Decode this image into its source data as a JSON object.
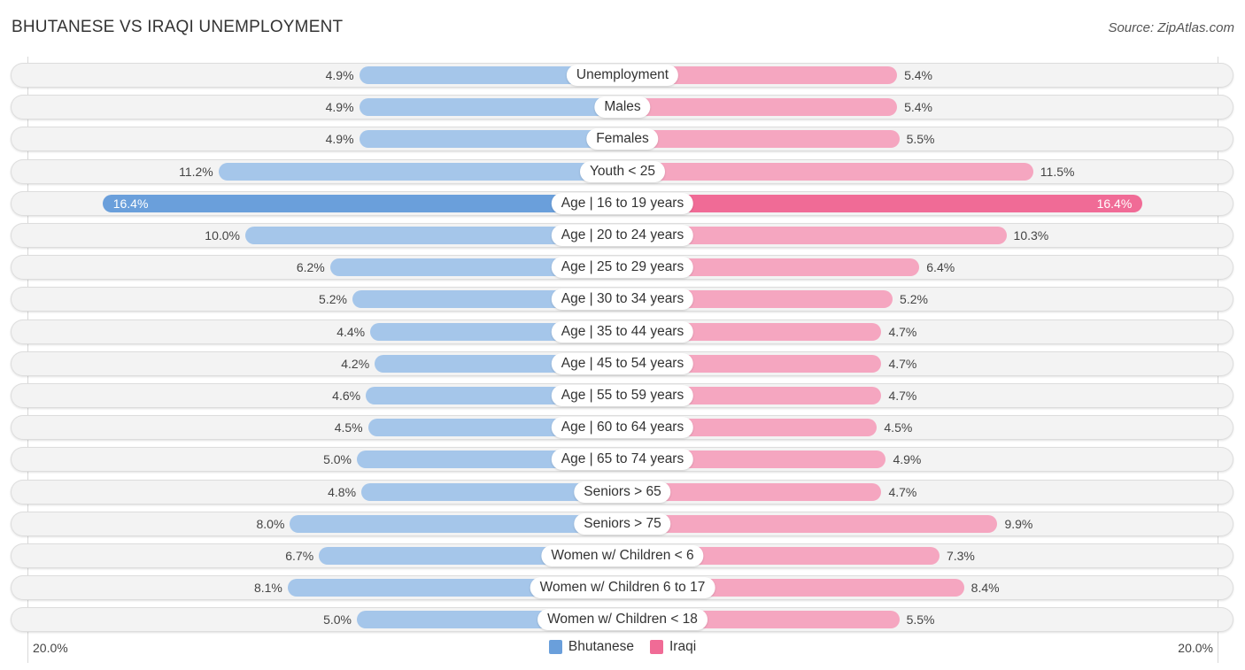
{
  "header": {
    "title": "BHUTANESE VS IRAQI UNEMPLOYMENT",
    "source": "Source: ZipAtlas.com"
  },
  "colors": {
    "bhutanese": "#a5c6ea",
    "bhutanese_strong": "#6a9fdb",
    "iraqi": "#f5a6c0",
    "iraqi_strong": "#f06b96"
  },
  "chart_data": {
    "type": "bar",
    "orientation": "horizontal-diverging",
    "title": "BHUTANESE VS IRAQI UNEMPLOYMENT",
    "categories": [
      "Unemployment",
      "Males",
      "Females",
      "Youth < 25",
      "Age | 16 to 19 years",
      "Age | 20 to 24 years",
      "Age | 25 to 29 years",
      "Age | 30 to 34 years",
      "Age | 35 to 44 years",
      "Age | 45 to 54 years",
      "Age | 55 to 59 years",
      "Age | 60 to 64 years",
      "Age | 65 to 74 years",
      "Seniors > 65",
      "Seniors > 75",
      "Women w/ Children < 6",
      "Women w/ Children 6 to 17",
      "Women w/ Children < 18"
    ],
    "series": [
      {
        "name": "Bhutanese",
        "side": "left",
        "values": [
          4.9,
          4.9,
          4.9,
          11.2,
          16.4,
          10.0,
          6.2,
          5.2,
          4.4,
          4.2,
          4.6,
          4.5,
          5.0,
          4.8,
          8.0,
          6.7,
          8.1,
          5.0
        ],
        "labels": [
          "4.9%",
          "4.9%",
          "4.9%",
          "11.2%",
          "16.4%",
          "10.0%",
          "6.2%",
          "5.2%",
          "4.4%",
          "4.2%",
          "4.6%",
          "4.5%",
          "5.0%",
          "4.8%",
          "8.0%",
          "6.7%",
          "8.1%",
          "5.0%"
        ]
      },
      {
        "name": "Iraqi",
        "side": "right",
        "values": [
          5.4,
          5.4,
          5.5,
          11.5,
          16.4,
          10.3,
          6.4,
          5.2,
          4.7,
          4.7,
          4.7,
          4.5,
          4.9,
          4.7,
          9.9,
          7.3,
          8.4,
          5.5
        ],
        "labels": [
          "5.4%",
          "5.4%",
          "5.5%",
          "11.5%",
          "16.4%",
          "10.3%",
          "6.4%",
          "5.2%",
          "4.7%",
          "4.7%",
          "4.7%",
          "4.5%",
          "4.9%",
          "4.7%",
          "9.9%",
          "7.3%",
          "8.4%",
          "5.5%"
        ]
      }
    ],
    "xlim": [
      0,
      20
    ],
    "axis_labels": {
      "left": "20.0%",
      "right": "20.0%"
    },
    "legend": {
      "position": "bottom-center",
      "entries": [
        "Bhutanese",
        "Iraqi"
      ]
    },
    "grid": false
  }
}
